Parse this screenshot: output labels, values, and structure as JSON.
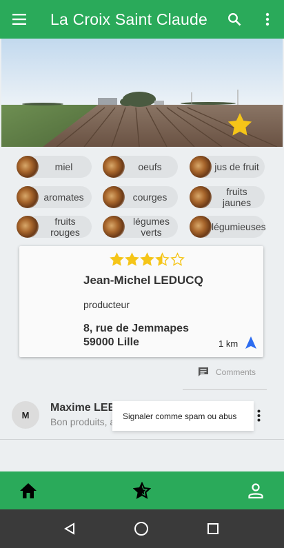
{
  "appbar": {
    "title": "La Croix Saint Claude",
    "menu_icon": "hamburger-menu-icon",
    "search_icon": "search-icon",
    "more_icon": "more-vert-icon",
    "color": "#2aaa5a"
  },
  "hero": {
    "image": "farm-field-photo",
    "favorite_icon": "star-icon",
    "favorite_color": "#f5c518"
  },
  "categories": [
    {
      "label": "miel"
    },
    {
      "label": "oeufs"
    },
    {
      "label": "jus de fruit"
    },
    {
      "label": "aromates"
    },
    {
      "label": "courges"
    },
    {
      "label": "fruits jaunes"
    },
    {
      "label": "fruits rouges"
    },
    {
      "label": "légumes verts"
    },
    {
      "label": "légumieuses"
    }
  ],
  "producer": {
    "rating": 3.5,
    "rating_max": 5,
    "name": "Jean-Michel LEDUCQ",
    "role": "producteur",
    "address_line1": "8, rue de Jemmapes",
    "address_line2": "59000 Lille",
    "distance": "1 km",
    "navigate_icon": "navigation-arrow-icon"
  },
  "comments": {
    "button_label": "Comments",
    "icon": "comment-icon",
    "items": [
      {
        "initial": "M",
        "author": "Maxime LEE",
        "text": "Bon produits, a"
      }
    ]
  },
  "popup_menu": {
    "item": "Signaler comme spam ou abus"
  },
  "bottom_nav": {
    "items": [
      "home-icon",
      "star-rating-icon",
      "account-icon"
    ]
  },
  "system_nav": {
    "items": [
      "back-icon",
      "home-circle-icon",
      "recents-icon"
    ]
  }
}
